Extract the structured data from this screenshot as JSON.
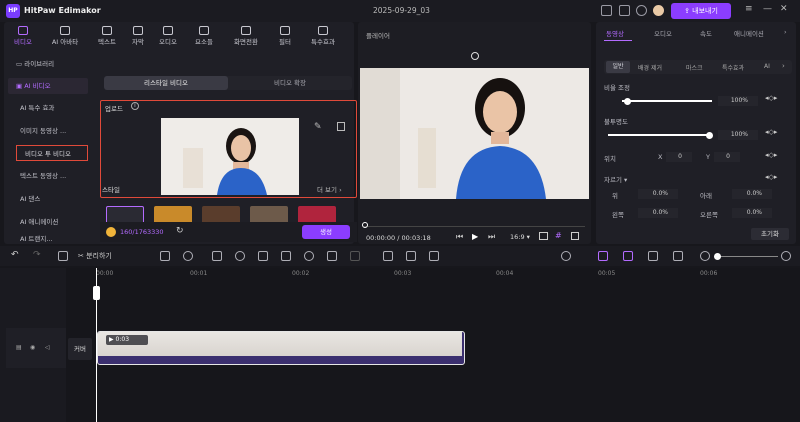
{
  "app": {
    "name": "HitPaw Edimakor",
    "doc_title": "2025-09-29_03",
    "export_label": "내보내기"
  },
  "toolbar_tabs": [
    {
      "label": "비디오",
      "icon": "video-icon"
    },
    {
      "label": "AI 아바타",
      "icon": "avatar-icon"
    },
    {
      "label": "텍스트",
      "icon": "text-icon"
    },
    {
      "label": "자막",
      "icon": "subtitle-icon"
    },
    {
      "label": "오디오",
      "icon": "audio-icon"
    },
    {
      "label": "요소들",
      "icon": "elements-icon"
    },
    {
      "label": "화면전환",
      "icon": "transition-icon"
    },
    {
      "label": "필터",
      "icon": "filter-icon"
    },
    {
      "label": "특수효과",
      "icon": "effects-icon"
    }
  ],
  "sidebar": [
    {
      "label": "라이브러리"
    },
    {
      "label": "AI 비디오"
    },
    {
      "label": "AI 특수 효과"
    },
    {
      "label": "이미지 동영상 ..."
    },
    {
      "label": "비디오 투 비디오"
    },
    {
      "label": "텍스트 동영상 ..."
    },
    {
      "label": "AI 댄스"
    },
    {
      "label": "AI 애니메이션"
    },
    {
      "label": "AI 트랜지..."
    }
  ],
  "subtabs": {
    "left": "리스타일 비디오",
    "right": "비디오 확장"
  },
  "upload": {
    "label": "업로드"
  },
  "style": {
    "label": "스타일",
    "more": "더 보기"
  },
  "credits": {
    "value": "160/1763330"
  },
  "generate_label": "생성",
  "player": {
    "title": "플레이어",
    "time": "00:00:00 / 00:03:18",
    "ratio": "16:9"
  },
  "right": {
    "tabs": [
      "동영상",
      "오디오",
      "속도",
      "애니메이션"
    ],
    "subtabs": [
      "일반",
      "배경 제거",
      "마스크",
      "특수효과",
      "AI"
    ],
    "scale_label": "비율 조정",
    "scale_value": "100%",
    "opacity_label": "불투명도",
    "opacity_value": "100%",
    "position_label": "위치",
    "x_label": "X",
    "x_value": "0",
    "y_label": "Y",
    "y_value": "0",
    "crop_label": "자르기",
    "crop_top_label": "위",
    "crop_top": "0.0%",
    "crop_bottom_label": "아래",
    "crop_bottom": "0.0%",
    "crop_left_label": "왼쪽",
    "crop_left": "0.0%",
    "crop_right_label": "오른쪽",
    "crop_right": "0.0%",
    "reset_label": "초기화"
  },
  "timeline": {
    "split_label": "분리하기",
    "ticks": [
      "00:00",
      "00:01",
      "00:02",
      "00:03",
      "00:04",
      "00:05",
      "00:06"
    ],
    "track_label": "커버",
    "clip_duration": "0:03"
  }
}
